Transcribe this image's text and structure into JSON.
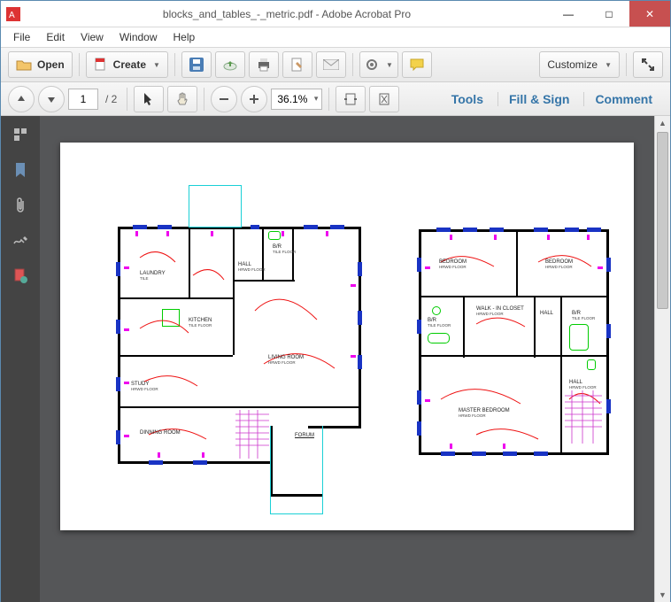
{
  "window": {
    "title": "blocks_and_tables_-_metric.pdf - Adobe Acrobat Pro",
    "minimize": "—",
    "maximize": "□",
    "close": "✕"
  },
  "menubar": [
    "File",
    "Edit",
    "View",
    "Window",
    "Help"
  ],
  "toolbar": {
    "open": "Open",
    "create": "Create",
    "customize": "Customize"
  },
  "nav": {
    "page_current": "1",
    "page_total": "/ 2",
    "zoom": "36.1%"
  },
  "panels": {
    "tools": "Tools",
    "fillsign": "Fill & Sign",
    "comment": "Comment"
  },
  "floorplan": {
    "left": {
      "rooms": {
        "laundry": {
          "name": "LAUNDRY",
          "floor": "TILE"
        },
        "kitchen": {
          "name": "KITCHEN",
          "floor": "TILE FLOOR"
        },
        "study": {
          "name": "STUDY",
          "floor": "HRWD FLOOR"
        },
        "dinning": {
          "name": "DINNING ROOM"
        },
        "living": {
          "name": "LIVING ROOM",
          "floor": "HRWD FLOOR"
        },
        "hall": {
          "name": "HALL",
          "floor": "HRWD FLOOR"
        },
        "br": {
          "name": "B/R",
          "floor": "TILE FLOOR"
        },
        "forum": {
          "name": "FORUM"
        }
      }
    },
    "right": {
      "rooms": {
        "bedroom1": {
          "name": "BEDROOM",
          "floor": "HRWD FLOOR"
        },
        "bedroom2": {
          "name": "BEDROOM",
          "floor": "HRWD FLOOR"
        },
        "walkin": {
          "name": "WALK - IN CLOSET",
          "floor": "HRWD FLOOR"
        },
        "hall1": {
          "name": "HALL"
        },
        "br1": {
          "name": "B/R",
          "floor": "TILE FLOOR"
        },
        "br2": {
          "name": "B/R",
          "floor": "TILE FLOOR"
        },
        "master": {
          "name": "MASTER BEDROOM",
          "floor": "HRWD FLOOR"
        },
        "hall2": {
          "name": "HALL",
          "floor": "HRWD FLOOR"
        }
      }
    }
  }
}
